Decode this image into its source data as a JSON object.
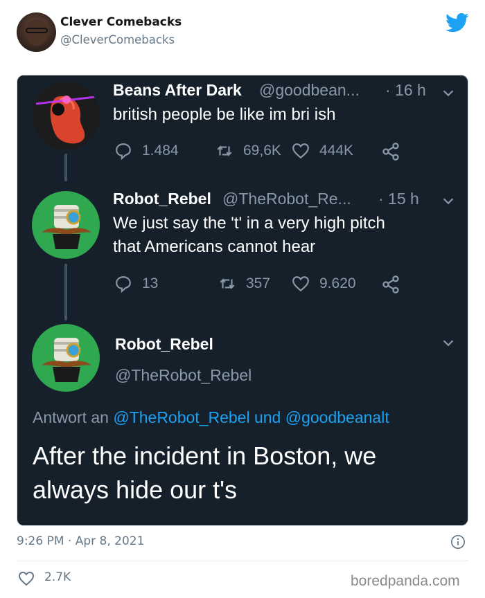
{
  "outer_tweet": {
    "name": "Clever Comebacks",
    "handle": "@CleverComebacks",
    "timestamp": "9:26 PM · Apr 8, 2021",
    "likes": "2.7K"
  },
  "embedded": {
    "tweet1": {
      "name": "Beans After Dark",
      "handle": "@goodbean...",
      "time": "· 16 h",
      "text": "british people be like im bri ish",
      "replies": "1.484",
      "retweets": "69,6K",
      "likes": "444K"
    },
    "tweet2": {
      "name": "Robot_Rebel",
      "handle": "@TheRobot_Re...",
      "time": "· 15 h",
      "text_line1": "We just say the 't' in a very high pitch",
      "text_line2": "that Americans cannot hear",
      "replies": "13",
      "retweets": "357",
      "likes": "9.620"
    },
    "tweet3": {
      "name": "Robot_Rebel",
      "handle": "@TheRobot_Rebel",
      "reply_prefix": "Antwort an ",
      "reply_link": "@TheRobot_Rebel und @goodbeanalt",
      "text_line1": "After the incident in Boston, we",
      "text_line2": "always hide our t's"
    }
  },
  "watermark": "boredpanda.com",
  "colors": {
    "twitter_blue": "#1da1f2",
    "dark_bg": "#15202b",
    "muted": "#8899a6"
  },
  "icons": [
    "twitter-bird-icon",
    "chevron-down-icon",
    "reply-icon",
    "retweet-icon",
    "heart-icon",
    "share-icon",
    "info-icon"
  ]
}
